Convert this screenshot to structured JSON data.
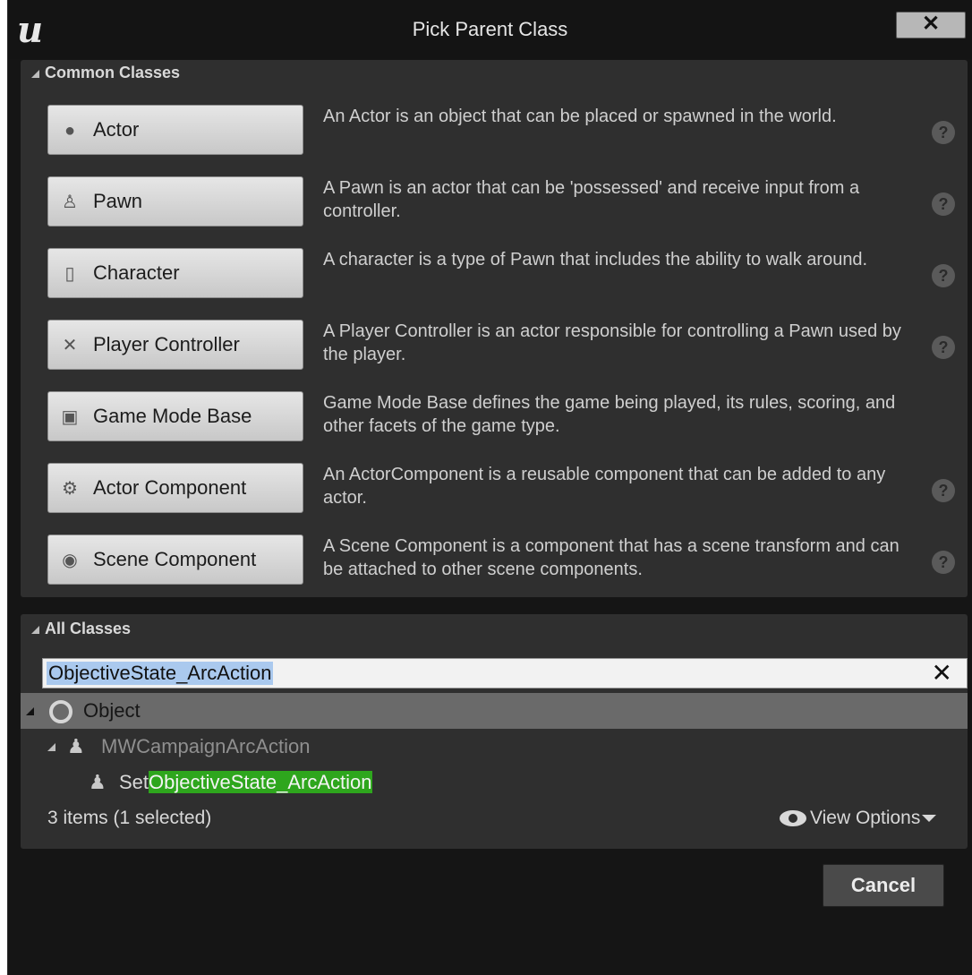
{
  "window": {
    "title": "Pick Parent Class",
    "close_label": "✕"
  },
  "common": {
    "header": "Common Classes",
    "classes": [
      {
        "label": "Actor",
        "icon": "sphere-icon",
        "desc": "An Actor is an object that can be placed or spawned in the world.",
        "help": "?"
      },
      {
        "label": "Pawn",
        "icon": "pawn-icon",
        "desc": "A Pawn is an actor that can be 'possessed' and receive input from a controller.",
        "help": "?"
      },
      {
        "label": "Character",
        "icon": "character-icon",
        "desc": "A character is a type of Pawn that includes the ability to walk around.",
        "help": "?"
      },
      {
        "label": "Player Controller",
        "icon": "controller-icon",
        "desc": "A Player Controller is an actor responsible for controlling a Pawn used by the player.",
        "help": "?"
      },
      {
        "label": "Game Mode Base",
        "icon": "game-mode-icon",
        "desc": "Game Mode Base defines the game being played, its rules, scoring, and other facets of the game type.",
        "help": ""
      },
      {
        "label": "Actor Component",
        "icon": "actor-component-icon",
        "desc": "An ActorComponent is a reusable component that can be added to any actor.",
        "help": "?"
      },
      {
        "label": "Scene Component",
        "icon": "scene-component-icon",
        "desc": "A Scene Component is a component that has a scene transform and can be attached to other scene components.",
        "help": "?"
      }
    ]
  },
  "all": {
    "header": "All Classes",
    "search_value": "ObjectiveState_ArcAction",
    "clear_label": "✕",
    "tree": {
      "root": "Object",
      "child": "MWCampaignArcAction",
      "leaf_prefix": "Set",
      "leaf_match": "ObjectiveState_ArcAction"
    },
    "status": "3 items (1 selected)",
    "view_options": "View Options"
  },
  "footer": {
    "cancel_label": "Cancel"
  }
}
